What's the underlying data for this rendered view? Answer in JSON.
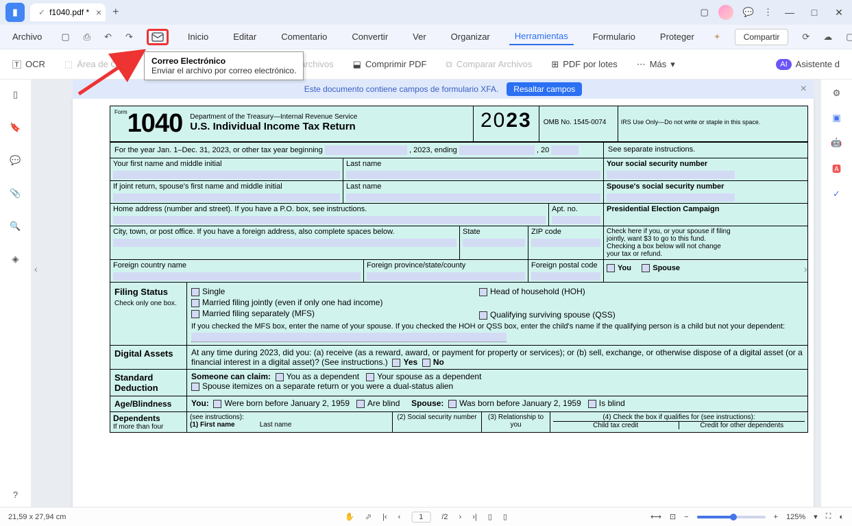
{
  "titlebar": {
    "filename": "f1040.pdf *",
    "window_controls": {
      "min": "—",
      "max": "□",
      "close": "✕"
    }
  },
  "quickbar": {
    "archivo": "Archivo",
    "menu": [
      "Inicio",
      "Editar",
      "Comentario",
      "Convertir",
      "Ver",
      "Organizar",
      "Herramientas",
      "Formulario",
      "Proteger"
    ],
    "active_index": 6,
    "compartir": "Compartir"
  },
  "tooltip": {
    "title": "Correo Electrónico",
    "desc": "Enviar el archivo por correo electrónico."
  },
  "toolbar2": {
    "ocr": "OCR",
    "area_ocr": "Área de OCR",
    "combinar": "Combinar archivos",
    "comprimir": "Comprimir PDF",
    "comparar": "Comparar Archivos",
    "por_lotes": "PDF por lotes",
    "mas": "Más",
    "asistente": "Asistente d"
  },
  "xfa": {
    "msg": "Este documento contiene campos de formulario XFA.",
    "btn": "Resaltar campos"
  },
  "f1040": {
    "form_label": "Form",
    "form_no": "1040",
    "dept": "Department of the Treasury—Internal Revenue Service",
    "title": "U.S. Individual Income Tax Return",
    "year_light": "20",
    "year_bold": "23",
    "omb": "OMB No. 1545-0074",
    "irs_only": "IRS Use Only—Do not write or staple in this space.",
    "tax_year_a": "For the year Jan. 1–Dec. 31, 2023, or other tax year beginning",
    "tax_year_b": ", 2023, ending",
    "tax_year_c": ", 20",
    "separate": "See separate instructions.",
    "first_name": "Your first name and middle initial",
    "last_name": "Last name",
    "your_ssn": "Your social security number",
    "joint": "If joint return, spouse's first name and middle initial",
    "spouse_last": "Last name",
    "spouse_ssn": "Spouse's social security number",
    "home": "Home address (number and street). If you have a P.O. box, see instructions.",
    "apt": "Apt. no.",
    "pec_title": "Presidential Election Campaign",
    "pec_text": "Check here if you, or your spouse if filing jointly, want $3 to go to this fund. Checking a box below will not change your tax or refund.",
    "you": "You",
    "spouse": "Spouse",
    "city": "City, town, or post office. If you have a foreign address, also complete spaces below.",
    "state": "State",
    "zip": "ZIP code",
    "fcountry": "Foreign country name",
    "fprov": "Foreign province/state/county",
    "fpostal": "Foreign postal code",
    "filing_status": "Filing Status",
    "check_one": "Check only one box.",
    "single": "Single",
    "mfj": "Married filing jointly (even if only one had income)",
    "mfs": "Married filing separately (MFS)",
    "hoh": "Head of household (HOH)",
    "qss": "Qualifying surviving spouse (QSS)",
    "mfs_note": "If you checked the MFS box, enter the name of your spouse. If you checked the HOH or QSS box, enter the child's name if the qualifying person is a child but not your dependent:",
    "digital": "Digital Assets",
    "digital_q": "At any time during 2023, did you: (a) receive (as a reward, award, or payment for property or services); or (b) sell, exchange, or otherwise dispose of a digital asset (or a financial interest in a digital asset)? (See instructions.)",
    "yes": "Yes",
    "no": "No",
    "std_ded": "Standard Deduction",
    "someone": "Someone can claim:",
    "you_dep": "You as a dependent",
    "spouse_dep": "Your spouse as a dependent",
    "spouse_item": "Spouse itemizes on a separate return or you were a dual-status alien",
    "age": "Age/Blindness",
    "you_colon": "You:",
    "born": "Were born before January 2, 1959",
    "blind": "Are blind",
    "spouse_colon": "Spouse:",
    "was_born": "Was born before January 2, 1959",
    "is_blind": "Is blind",
    "dependents": "Dependents",
    "see_instr": "(see instructions):",
    "if_more": "If more than four",
    "d1": "(1) First name",
    "d1b": "Last name",
    "d2": "(2) Social security number",
    "d3": "(3) Relationship to you",
    "d4": "(4) Check the box if qualifies for (see instructions):",
    "d4a": "Child tax credit",
    "d4b": "Credit for other dependents"
  },
  "statusbar": {
    "hint": "21,59 x 27,94 cm",
    "page": "1",
    "total": "/2",
    "zoom": "125%"
  }
}
